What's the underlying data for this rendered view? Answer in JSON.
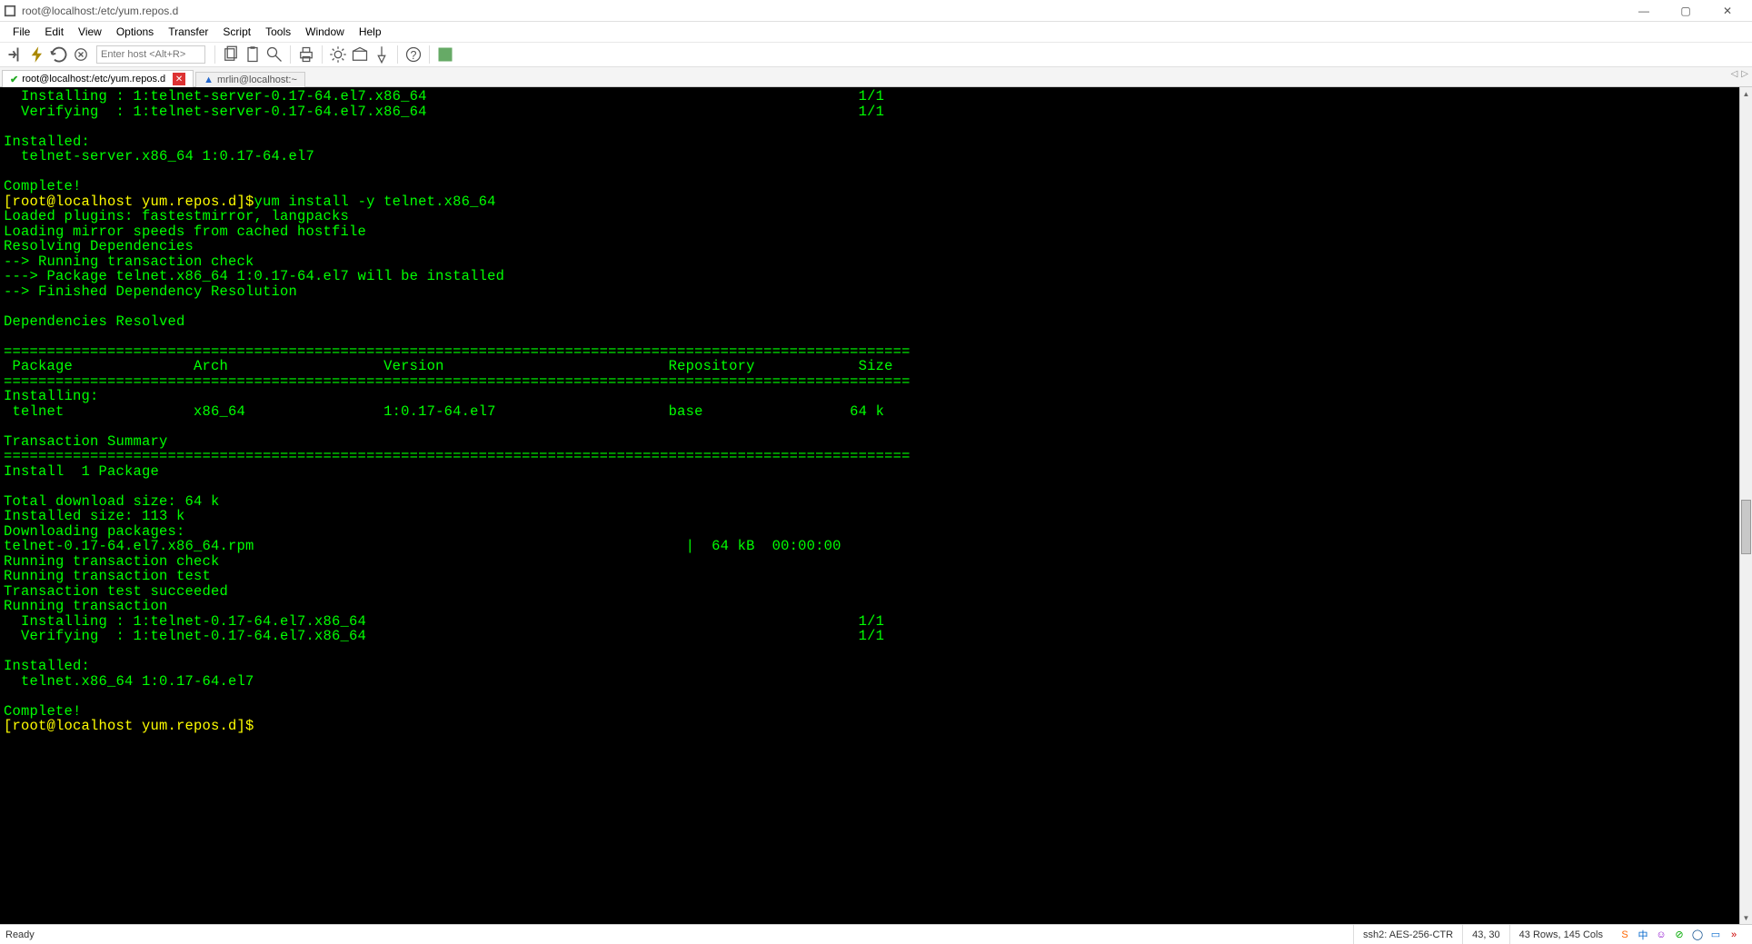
{
  "window": {
    "title": "root@localhost:/etc/yum.repos.d",
    "min_icon": "—",
    "max_icon": "▢",
    "close_icon": "✕"
  },
  "menu": [
    "File",
    "Edit",
    "View",
    "Options",
    "Transfer",
    "Script",
    "Tools",
    "Window",
    "Help"
  ],
  "toolbar": {
    "host_placeholder": "Enter host <Alt+R>"
  },
  "tabs": [
    {
      "label": "root@localhost:/etc/yum.repos.d",
      "state": "active",
      "icon": "check"
    },
    {
      "label": "mrlin@localhost:~",
      "state": "inactive",
      "icon": "warn"
    }
  ],
  "tab_arrows": {
    "left": "◁",
    "right": "▷"
  },
  "terminal": {
    "lines": [
      {
        "text": "  Installing : 1:telnet-server-0.17-64.el7.x86_64                                                  1/1",
        "cls": "green"
      },
      {
        "text": "  Verifying  : 1:telnet-server-0.17-64.el7.x86_64                                                  1/1",
        "cls": "green"
      },
      {
        "text": "",
        "cls": "green"
      },
      {
        "text": "Installed:",
        "cls": "green"
      },
      {
        "text": "  telnet-server.x86_64 1:0.17-64.el7",
        "cls": "green"
      },
      {
        "text": "",
        "cls": "green"
      },
      {
        "text": "Complete!",
        "cls": "green"
      },
      {
        "segments": [
          {
            "text": "[root@localhost yum.repos.d]$",
            "cls": "yellow"
          },
          {
            "text": "yum install -y telnet.x86_64",
            "cls": "green"
          }
        ]
      },
      {
        "text": "Loaded plugins: fastestmirror, langpacks",
        "cls": "green"
      },
      {
        "text": "Loading mirror speeds from cached hostfile",
        "cls": "green"
      },
      {
        "text": "Resolving Dependencies",
        "cls": "green"
      },
      {
        "text": "--> Running transaction check",
        "cls": "green"
      },
      {
        "text": "---> Package telnet.x86_64 1:0.17-64.el7 will be installed",
        "cls": "green"
      },
      {
        "text": "--> Finished Dependency Resolution",
        "cls": "green"
      },
      {
        "text": "",
        "cls": "green"
      },
      {
        "text": "Dependencies Resolved",
        "cls": "green"
      },
      {
        "text": "",
        "cls": "green"
      },
      {
        "text": "=========================================================================================================",
        "cls": "green"
      },
      {
        "text": " Package              Arch                  Version                          Repository            Size",
        "cls": "green"
      },
      {
        "text": "=========================================================================================================",
        "cls": "green"
      },
      {
        "text": "Installing:",
        "cls": "green"
      },
      {
        "text": " telnet               x86_64                1:0.17-64.el7                    base                 64 k",
        "cls": "green"
      },
      {
        "text": "",
        "cls": "green"
      },
      {
        "text": "Transaction Summary",
        "cls": "green"
      },
      {
        "text": "=========================================================================================================",
        "cls": "green"
      },
      {
        "text": "Install  1 Package",
        "cls": "green"
      },
      {
        "text": "",
        "cls": "green"
      },
      {
        "text": "Total download size: 64 k",
        "cls": "green"
      },
      {
        "text": "Installed size: 113 k",
        "cls": "green"
      },
      {
        "text": "Downloading packages:",
        "cls": "green"
      },
      {
        "text": "telnet-0.17-64.el7.x86_64.rpm                                                  |  64 kB  00:00:00",
        "cls": "green"
      },
      {
        "text": "Running transaction check",
        "cls": "green"
      },
      {
        "text": "Running transaction test",
        "cls": "green"
      },
      {
        "text": "Transaction test succeeded",
        "cls": "green"
      },
      {
        "text": "Running transaction",
        "cls": "green"
      },
      {
        "text": "  Installing : 1:telnet-0.17-64.el7.x86_64                                                         1/1",
        "cls": "green"
      },
      {
        "text": "  Verifying  : 1:telnet-0.17-64.el7.x86_64                                                         1/1",
        "cls": "green"
      },
      {
        "text": "",
        "cls": "green"
      },
      {
        "text": "Installed:",
        "cls": "green"
      },
      {
        "text": "  telnet.x86_64 1:0.17-64.el7",
        "cls": "green"
      },
      {
        "text": "",
        "cls": "green"
      },
      {
        "text": "Complete!",
        "cls": "green"
      },
      {
        "segments": [
          {
            "text": "[root@localhost yum.repos.d]$",
            "cls": "yellow"
          }
        ]
      }
    ]
  },
  "status": {
    "ready": "Ready",
    "cipher": "ssh2: AES-256-CTR",
    "pos": "43, 30",
    "size": "43 Rows, 145 Cols",
    "icons": {
      "logo": "S",
      "cn": "中",
      "face": "☺",
      "safe": "⊘",
      "download": "◯",
      "folder": "▭",
      "wifi": "»"
    }
  }
}
